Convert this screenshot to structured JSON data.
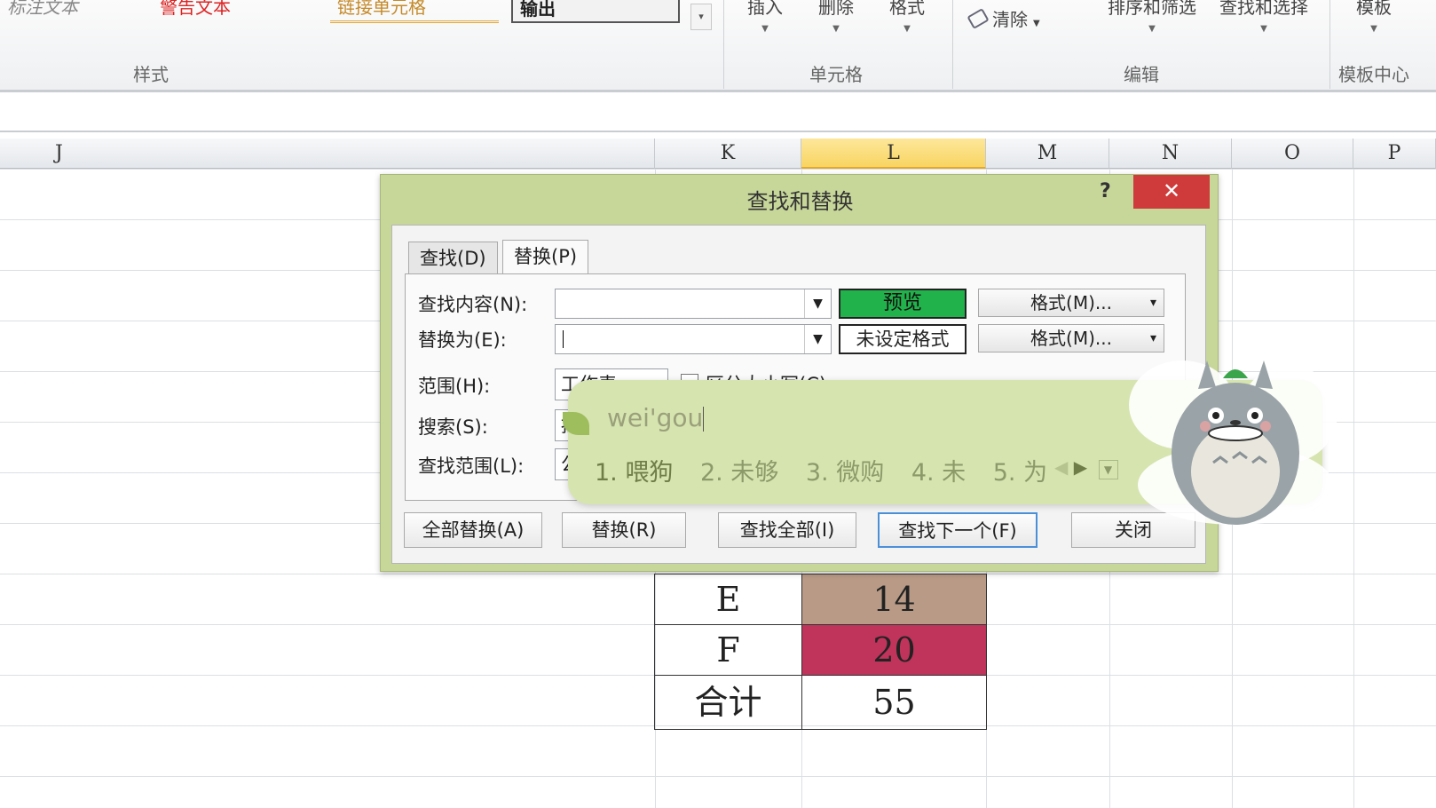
{
  "ribbon": {
    "styles": {
      "cell1": "标注文本",
      "cell2": "警告文本",
      "cell3": "链接单元格",
      "cell4": "输出",
      "group_label": "样式"
    },
    "cells": {
      "insert": "插入",
      "delete": "删除",
      "format": "格式",
      "group_label": "单元格"
    },
    "editing": {
      "clear": "清除",
      "sort_filter": "排序和筛选",
      "find_select": "查找和选择",
      "group_label": "编辑"
    },
    "template": {
      "button": "模板",
      "group_label": "模板中心"
    }
  },
  "columns": [
    {
      "id": "J",
      "label": "J"
    },
    {
      "id": "K",
      "label": "K"
    },
    {
      "id": "L",
      "label": "L"
    },
    {
      "id": "M",
      "label": "M"
    },
    {
      "id": "N",
      "label": "N"
    },
    {
      "id": "O",
      "label": "O"
    },
    {
      "id": "P",
      "label": "P"
    }
  ],
  "table": {
    "rows": [
      {
        "label": "E",
        "value": "14",
        "color": "#b89a86"
      },
      {
        "label": "F",
        "value": "20",
        "color": "#c0335b"
      },
      {
        "label": "合计",
        "value": "55",
        "color": "#ffffff"
      }
    ]
  },
  "dialog": {
    "title": "查找和替换",
    "help": "?",
    "close": "✕",
    "tabs": [
      "查找(D)",
      "替换(P)"
    ],
    "find_label": "查找内容(N):",
    "find_value": "",
    "replace_label": "替换为(E):",
    "replace_value": "",
    "preview": "预览",
    "no_format": "未设定格式",
    "format_btn": "格式(M)...",
    "scope_label": "范围(H):",
    "scope_value": "工作表",
    "match_case": "区分大小写(C)",
    "search_label": "搜索(S):",
    "search_value": "按行",
    "lookin_label": "查找范围(L):",
    "lookin_value": "公式",
    "buttons": {
      "replace_all": "全部替换(A)",
      "replace": "替换(R)",
      "find_all": "查找全部(I)",
      "find_next": "查找下一个(F)",
      "close": "关闭"
    }
  },
  "ime": {
    "input": "wei'gou",
    "candidates": [
      "1. 喂狗",
      "2. 未够",
      "3. 微购",
      "4. 未",
      "5. 为"
    ]
  }
}
